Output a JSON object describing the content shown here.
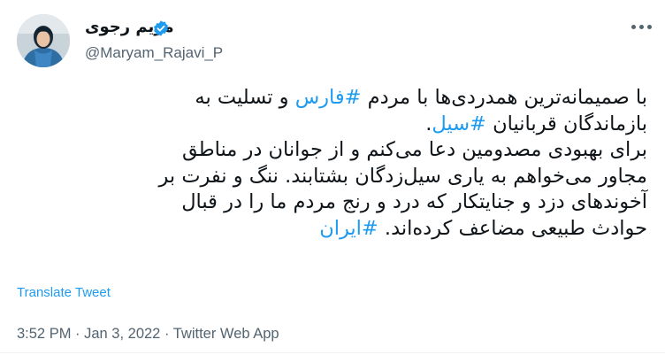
{
  "author": {
    "display_name": "مریم رجوی",
    "handle": "@Maryam_Rajavi_P",
    "verified": true,
    "verified_color": "#1d9bf0",
    "avatar_icon": "profile-photo"
  },
  "more_icon": "more-options-icon",
  "tweet": {
    "lines": [
      [
        {
          "text": "با صمیمانه‌ترین همدردی‌ها با مردم ",
          "tag": false
        },
        {
          "text": "#فارس",
          "tag": true
        },
        {
          "text": " و تسلیت به",
          "tag": false
        }
      ],
      [
        {
          "text": "بازماندگان قربانیان ",
          "tag": false
        },
        {
          "text": "#سیل",
          "tag": true
        },
        {
          "text": ".",
          "tag": false
        }
      ],
      [
        {
          "text": "برای بهبودی مصدومین دعا می‌کنم و از جوانان در مناطق",
          "tag": false
        }
      ],
      [
        {
          "text": "مجاور می‌خواهم به یاری سیل‌زدگان بشتابند. ننگ و نفرت بر",
          "tag": false
        }
      ],
      [
        {
          "text": "آخوندهای دزد و جنایتکار که درد و رنج مردم ما را در قبال",
          "tag": false
        }
      ],
      [
        {
          "text": "حوادث طبیعی مضاعف کرده‌اند. ",
          "tag": false
        },
        {
          "text": "#ایران",
          "tag": true
        }
      ]
    ]
  },
  "translate_label": "Translate Tweet",
  "meta": {
    "time": "3:52 PM",
    "separator": " · ",
    "date": "Jan 3, 2022",
    "source": "Twitter Web App"
  },
  "colors": {
    "link": "#1d9bf0",
    "text": "#0f1419",
    "secondary": "#536471"
  }
}
